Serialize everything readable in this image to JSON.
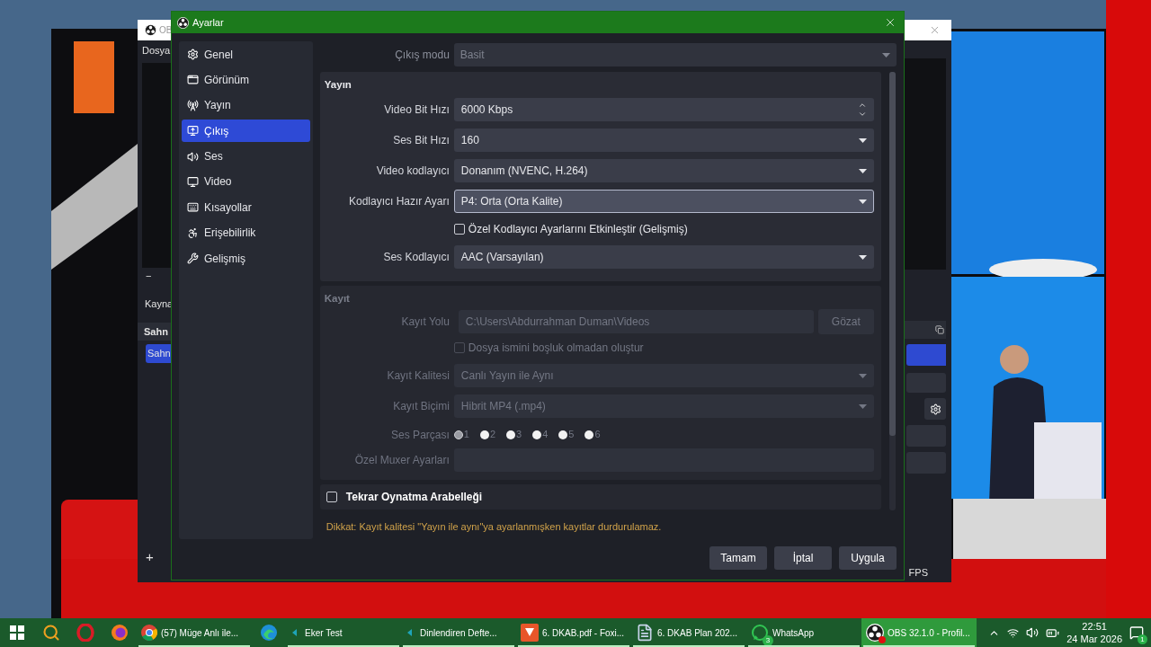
{
  "background_window": {
    "title": "OB",
    "menu": "Dosya",
    "zoom_minus": "−",
    "sources_label": "Kayna",
    "scenes_header": "Sahn",
    "scenes": [
      {
        "label": "Sahn",
        "selected": true
      }
    ],
    "add_button": "+",
    "fps": "FPS"
  },
  "dialog": {
    "title": "Ayarlar",
    "sidebar": [
      {
        "label": "Genel",
        "selected": false
      },
      {
        "label": "Görünüm",
        "selected": false
      },
      {
        "label": "Yayın",
        "selected": false
      },
      {
        "label": "Çıkış",
        "selected": true
      },
      {
        "label": "Ses",
        "selected": false
      },
      {
        "label": "Video",
        "selected": false
      },
      {
        "label": "Kısayollar",
        "selected": false
      },
      {
        "label": "Erişebilirlik",
        "selected": false
      },
      {
        "label": "Gelişmiş",
        "selected": false
      }
    ],
    "output_mode": {
      "label": "Çıkış modu",
      "value": "Basit"
    },
    "groups": [
      {
        "title": "Yayın",
        "disabled": false,
        "rows": [
          {
            "kind": "spin",
            "label": "Video Bit Hızı",
            "value": "6000 Kbps",
            "focused": false
          },
          {
            "kind": "combo",
            "label": "Ses Bit Hızı",
            "value": "160",
            "focused": false
          },
          {
            "kind": "combo",
            "label": "Video kodlayıcı",
            "value": "Donanım (NVENC, H.264)",
            "focused": false
          },
          {
            "kind": "combo",
            "label": "Kodlayıcı Hazır Ayarı",
            "value": "P4: Orta (Orta Kalite)",
            "focused": true
          },
          {
            "kind": "checkbox",
            "label": "Özel Kodlayıcı Ayarlarını Etkinleştir (Gelişmiş)",
            "checked": false,
            "focused": false
          },
          {
            "kind": "combo",
            "label": "Ses Kodlayıcı",
            "value": "AAC (Varsayılan)",
            "focused": false
          }
        ]
      },
      {
        "title": "Kayıt",
        "disabled": true,
        "rows": [
          {
            "kind": "path",
            "label": "Kayıt Yolu",
            "value": "C:\\Users\\Abdurrahman Duman\\Videos",
            "button": "Gözat",
            "focused": false
          },
          {
            "kind": "checkbox",
            "label": "Dosya ismini boşluk olmadan oluştur",
            "checked": false,
            "focused": false
          },
          {
            "kind": "combo",
            "label": "Kayıt Kalitesi",
            "value": "Canlı Yayın ile Aynı",
            "focused": false
          },
          {
            "kind": "combo",
            "label": "Kayıt Biçimi",
            "value": "Hibrit MP4 (.mp4)",
            "focused": false
          },
          {
            "kind": "tracks",
            "label": "Ses Parçası",
            "focused": false,
            "tracks": [
              {
                "label": "1",
                "checked": true
              },
              {
                "label": "2",
                "checked": false
              },
              {
                "label": "3",
                "checked": false
              },
              {
                "label": "4",
                "checked": false
              },
              {
                "label": "5",
                "checked": false
              },
              {
                "label": "6",
                "checked": false
              }
            ]
          },
          {
            "kind": "text",
            "label": "Özel Muxer Ayarları",
            "focused": false
          }
        ]
      }
    ],
    "replay_buffer": {
      "label": "Tekrar Oynatma Arabelleği",
      "checked": false
    },
    "warning": "Dikkat: Kayıt kalitesi \"Yayın ile aynı\"ya ayarlanmışken kayıtlar durdurulamaz.",
    "buttons": [
      "Tamam",
      "İptal",
      "Uygula"
    ]
  },
  "taskbar": {
    "items": [
      {
        "running": false,
        "selected": false
      },
      {
        "running": false,
        "selected": false
      },
      {
        "running": false,
        "selected": false
      },
      {
        "running": false,
        "selected": false
      },
      {
        "label": "(57) Müge Anlı ile...",
        "running": true,
        "selected": false
      },
      {
        "running": false,
        "selected": false
      },
      {
        "label": "Eker Test",
        "running": true,
        "selected": false
      },
      {
        "label": "Dinlendiren Defte...",
        "running": true,
        "selected": false
      },
      {
        "label": "6. DKAB.pdf - Foxi...",
        "running": true,
        "selected": false
      },
      {
        "label": "6. DKAB Plan 202...",
        "running": true,
        "selected": false
      },
      {
        "label": "WhatsApp",
        "badge": "3",
        "running": true,
        "selected": false
      },
      {
        "label": "OBS 32.1.0 - Profil...",
        "running": true,
        "selected": true
      }
    ],
    "time": "22:51",
    "date": "24 Mar 2026",
    "notifications": "1"
  }
}
